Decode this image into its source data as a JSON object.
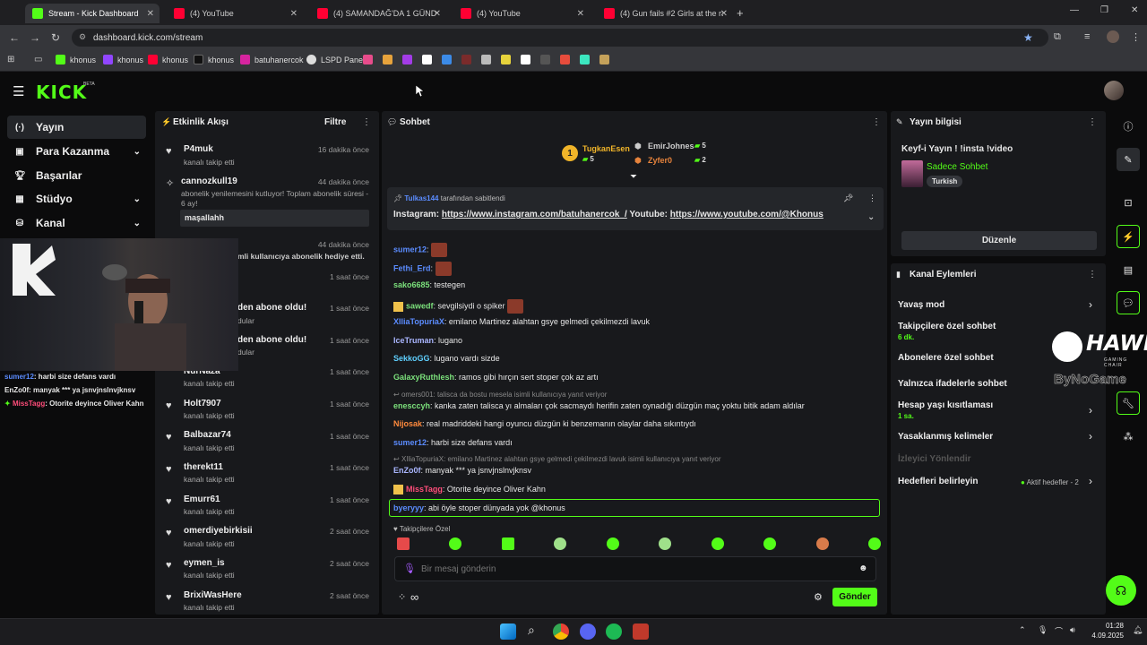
{
  "browser": {
    "tabs": [
      {
        "label": "Stream - Kick Dashboard",
        "active": true
      },
      {
        "label": "(4) YouTube"
      },
      {
        "label": "(4) SAMANDAĞ'DA 1 GÜNDE M"
      },
      {
        "label": "(4) YouTube"
      },
      {
        "label": "(4) Gun fails #2 Girls at the rang"
      }
    ],
    "url": "dashboard.kick.com/stream",
    "bookmarks": [
      "khonus",
      "khonus",
      "khonus",
      "khonus",
      "batuhanercok",
      "LSPD Panel"
    ]
  },
  "header": {
    "logo": "KICK",
    "badge": "BETA"
  },
  "sidebar": {
    "items": [
      {
        "label": "Yayın",
        "icon": "broadcast-icon"
      },
      {
        "label": "Para Kazanma",
        "icon": "money-icon"
      },
      {
        "label": "Başarılar",
        "icon": "trophy-icon"
      },
      {
        "label": "Stüdyo",
        "icon": "studio-icon"
      },
      {
        "label": "Kanal",
        "icon": "channel-icon"
      }
    ]
  },
  "activity": {
    "title": "Etkinlik Akışı",
    "filter": "Filtre",
    "items": [
      {
        "name": "P4muk",
        "sub": "kanalı takip etti",
        "time": "16 dakika önce"
      },
      {
        "name": "cannozkull19",
        "sub": "abonelik yenilemesini kutluyor! Toplam abonelik süresi - 6 ay!",
        "time": "44 dakika önce",
        "message": "maşallahh"
      },
      {
        "name": "",
        "sub": "mli kullanıcıya abonelik hediye etti.",
        "time": "44 dakika önce"
      },
      {
        "name": "",
        "sub": "",
        "time": "1 saat önce"
      },
      {
        "name": "den abone oldu!",
        "sub": "dular",
        "time": "1 saat önce"
      },
      {
        "name": "den abone oldu!",
        "sub": "dular",
        "time": "1 saat önce"
      },
      {
        "name": "NurNaza",
        "sub": "kanalı takip etti",
        "time": "1 saat önce"
      },
      {
        "name": "Holt7907",
        "sub": "kanalı takip etti",
        "time": "1 saat önce"
      },
      {
        "name": "Balbazar74",
        "sub": "kanalı takip etti",
        "time": "1 saat önce"
      },
      {
        "name": "therekt11",
        "sub": "kanalı takip etti",
        "time": "1 saat önce"
      },
      {
        "name": "Emurr61",
        "sub": "kanalı takip etti",
        "time": "1 saat önce"
      },
      {
        "name": "omerdiyebirkisii",
        "sub": "kanalı takip etti",
        "time": "2 saat önce"
      },
      {
        "name": "eymen_is",
        "sub": "kanalı takip etti",
        "time": "2 saat önce"
      },
      {
        "name": "BrixiWasHere",
        "sub": "kanalı takip etti",
        "time": "2 saat önce"
      }
    ]
  },
  "chat": {
    "title": "Sohbet",
    "leaders": [
      {
        "rank": "1",
        "name": "TugkanEsen",
        "count": "5"
      },
      {
        "name": "EmirJohnes",
        "count": "5"
      },
      {
        "name": "Zyfer0",
        "count": "2"
      }
    ],
    "pinned": {
      "by": "Tulkas144",
      "by_suffix": "tarafından sabitlendi",
      "text_prefix": "Instagram:",
      "link1": "https://www.instagram.com/batuhanercok_/",
      "mid": "Youtube:",
      "link2": "https://www.youtube.com/@Khonus"
    },
    "messages": [
      {
        "user": "sumer12",
        "text": ":",
        "color": "#5b8cff"
      },
      {
        "user": "Fethi_Erd",
        "text": ":",
        "color": "#5b8cff"
      },
      {
        "user": "sako6685",
        "text": ": testegen",
        "color": "#7be07b"
      },
      {
        "user": "sawedf",
        "text": ": sevgilsiydi o spiker",
        "color": "#7be07b"
      },
      {
        "user": "XIliaTopuriaX",
        "text": ": emilano Martinez alahtan gsye gelmedi çekilmezdi lavuk",
        "color": "#5b8cff"
      },
      {
        "user": "IceTruman",
        "text": ": lugano",
        "color": "#aab6ff"
      },
      {
        "user": "SekkoGG",
        "text": ": lugano vardı sizde",
        "color": "#5fd0ff"
      },
      {
        "user": "GalaxyRuthlesh",
        "text": ": ramos gibi hırçın sert stoper çok az artı",
        "color": "#7be07b"
      },
      {
        "reply": "omers001: talisca da bostu mesela isimli kullanıcıya yanıt veriyor"
      },
      {
        "user": "enesccyh",
        "text": ": kanka zaten talisca yı almaları çok sacmaydı herifin zaten oynadığı düzgün maç yoktu bitik adam aldılar",
        "color": "#7be07b"
      },
      {
        "user": "Nijosak",
        "text": ": real madriddeki hangi oyuncu düzgün ki benzemanın olaylar daha sıkıntıydı",
        "color": "#ff8a3d"
      },
      {
        "user": "sumer12",
        "text": ": harbi size defans vardı",
        "color": "#5b8cff"
      },
      {
        "reply": "XIliaTopuriaX: emilano Martinez alahtan gsye gelmedi çekilmezdi lavuk isimli kullanıcıya yanıt veriyor"
      },
      {
        "user": "EnZo0f",
        "text": ": manyak *** ya jsnvjnslnvjknsv",
        "color": "#aab6ff"
      },
      {
        "user": "MissTagg",
        "text": ": Otorite deyince Oliver Kahn",
        "color": "#ff4d7a"
      },
      {
        "user": "byeryyy",
        "text": ": abi öyle stoper dünyada yok @khonus",
        "color": "#5b8cff"
      }
    ],
    "followers_only": "Takipçilere Özel",
    "input_placeholder": "Bir mesaj gönderin",
    "send": "Gönder",
    "infinity": "∞"
  },
  "overlay_chat": [
    {
      "user": "sumer12",
      "text": ": harbi size defans vardı"
    },
    {
      "user": "EnZo0f",
      "text": ": manyak *** ya jsnvjnslnvjknsv"
    },
    {
      "user": "MissTagg",
      "text": ": Otorite deyince Oliver Kahn"
    }
  ],
  "stream_info": {
    "title": "Yayın bilgisi",
    "stream_title": "Keyf-i Yayın ! !insta !video",
    "category": "Sadece Sohbet",
    "tag": "Turkish",
    "edit": "Düzenle"
  },
  "channel_actions": {
    "title": "Kanal Eylemleri",
    "items": [
      {
        "label": "Yavaş mod"
      },
      {
        "label": "Takipçilere özel sohbet",
        "sub": "6 dk."
      },
      {
        "label": "Abonelere özel sohbet"
      },
      {
        "label": "Yalnızca ifadelerle sohbet"
      },
      {
        "label": "Hesap yaşı kısıtlaması",
        "sub": "1 sa."
      },
      {
        "label": "Yasaklanmış kelimeler"
      },
      {
        "label": "İzleyici Yönlendir"
      },
      {
        "label": "Hedefleri belirleyin",
        "extra": "Aktif hedefler - 2"
      }
    ]
  },
  "overlays": {
    "hawk": "HAWK",
    "hawk_sub": "GAMING CHAIR",
    "bynogame": "ByNoGame"
  },
  "taskbar": {
    "time": "01:28",
    "date": "4.09.2025"
  },
  "colors": {
    "accent": "#53fc18",
    "panel": "#18191c",
    "bg": "#0b0b0c"
  }
}
